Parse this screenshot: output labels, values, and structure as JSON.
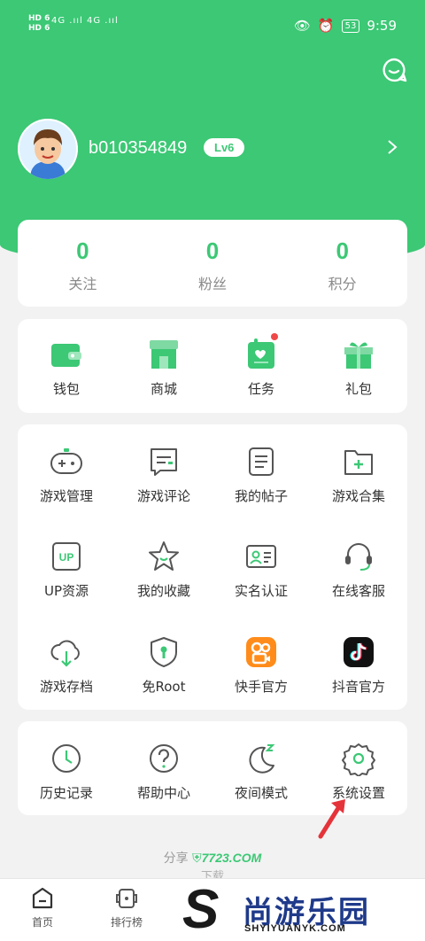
{
  "status_bar": {
    "network_top": "HD 6",
    "network_bottom": "HD 6",
    "signal1": "4G .ııl",
    "signal2": "4G .ııl",
    "battery": "53",
    "time": "9:59"
  },
  "profile": {
    "username": "b010354849",
    "level": "Lv6"
  },
  "stats": [
    {
      "value": "0",
      "label": "关注"
    },
    {
      "value": "0",
      "label": "粉丝"
    },
    {
      "value": "0",
      "label": "积分"
    }
  ],
  "quick": [
    {
      "label": "钱包",
      "icon": "wallet-icon"
    },
    {
      "label": "商城",
      "icon": "shop-icon"
    },
    {
      "label": "任务",
      "icon": "task-icon"
    },
    {
      "label": "礼包",
      "icon": "gift-icon"
    }
  ],
  "features": [
    {
      "label": "游戏管理",
      "icon": "gamepad-icon"
    },
    {
      "label": "游戏评论",
      "icon": "comment-icon"
    },
    {
      "label": "我的帖子",
      "icon": "post-icon"
    },
    {
      "label": "游戏合集",
      "icon": "folder-add-icon"
    },
    {
      "label": "UP资源",
      "icon": "up-icon"
    },
    {
      "label": "我的收藏",
      "icon": "star-icon"
    },
    {
      "label": "实名认证",
      "icon": "id-card-icon"
    },
    {
      "label": "在线客服",
      "icon": "headset-icon"
    },
    {
      "label": "游戏存档",
      "icon": "cloud-download-icon"
    },
    {
      "label": "免Root",
      "icon": "shield-icon"
    },
    {
      "label": "快手官方",
      "icon": "kuaishou-icon"
    },
    {
      "label": "抖音官方",
      "icon": "douyin-icon"
    }
  ],
  "settings": [
    {
      "label": "历史记录",
      "icon": "clock-icon"
    },
    {
      "label": "帮助中心",
      "icon": "help-icon"
    },
    {
      "label": "夜间模式",
      "icon": "moon-icon"
    },
    {
      "label": "系统设置",
      "icon": "gear-icon"
    }
  ],
  "share": {
    "prefix": "分享",
    "site": "7723.COM",
    "sub": "下载"
  },
  "tabs": [
    {
      "label": "首页",
      "icon": "home-icon"
    },
    {
      "label": "排行榜",
      "icon": "ranking-icon"
    }
  ],
  "watermark": {
    "cn": "尚游乐园",
    "en": "SHYIYUANYK.COM",
    "letter": "S"
  },
  "colors": {
    "accent": "#3cc875",
    "background": "#f2f2f2",
    "badge_dot": "#f04848"
  }
}
